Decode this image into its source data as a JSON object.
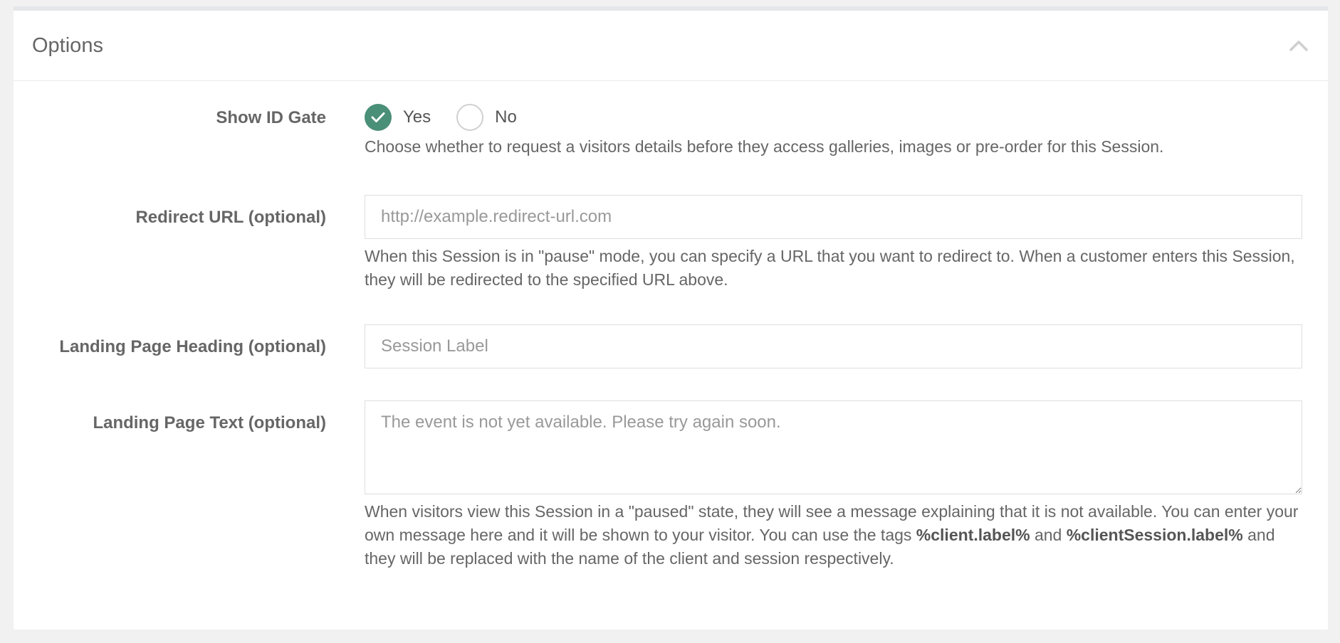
{
  "panel": {
    "title": "Options",
    "collapse_icon": "chevron-up-icon"
  },
  "id_gate": {
    "label": "Show ID Gate",
    "options": [
      {
        "label": "Yes",
        "selected": true
      },
      {
        "label": "No",
        "selected": false
      }
    ],
    "help": "Choose whether to request a visitors details before they access galleries, images or pre-order for this Session."
  },
  "redirect": {
    "label": "Redirect URL (optional)",
    "placeholder": "http://example.redirect-url.com",
    "value": "",
    "help": "When this Session is in \"pause\" mode, you can specify a URL that you want to redirect to. When a customer enters this Session, they will be redirected to the specified URL above."
  },
  "landing_heading": {
    "label": "Landing Page Heading (optional)",
    "placeholder": "Session Label",
    "value": ""
  },
  "landing_text": {
    "label": "Landing Page Text (optional)",
    "placeholder": "The event is not yet available. Please try again soon.",
    "value": "",
    "help_part1": "When visitors view this Session in a \"paused\" state, they will see a message explaining that it is not available. You can enter your own message here and it will be shown to your visitor. You can use the tags ",
    "tag1": "%client.label%",
    "help_part2": " and ",
    "tag2": "%clientSession.label%",
    "help_part3": " and they will be replaced with the name of the client and session respectively."
  },
  "colors": {
    "accent": "#4a8f78",
    "page_bg": "#f1f1f1",
    "panel_bg": "#ffffff"
  }
}
